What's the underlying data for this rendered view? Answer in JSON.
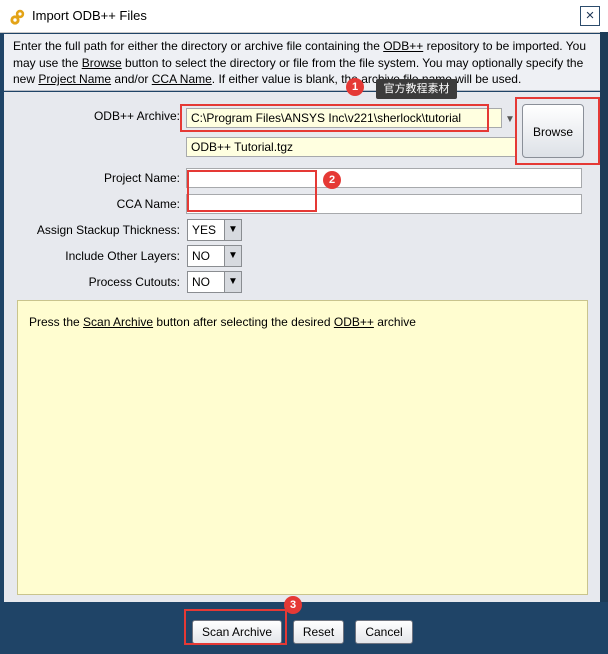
{
  "window": {
    "title": "Import ODB++ Files"
  },
  "description": {
    "p1": "Enter the full path for either the directory or archive file containing the ",
    "link_odb": "ODB++",
    "p2": " repository to be imported. You may use the ",
    "link_browse": "Browse",
    "p3": " button to select the directory or file from the file system. You may optionally specify the new ",
    "link_project": "Project Name",
    "p4": " and/or ",
    "link_cca": "CCA Name",
    "p5": ". If either value is blank, the archive file name will be used."
  },
  "form": {
    "archive_label": "ODB++ Archive:",
    "archive_path": "C:\\Program Files\\ANSYS Inc\\v221\\sherlock\\tutorial",
    "archive_file": "ODB++ Tutorial.tgz",
    "browse_label": "Browse",
    "project_label": "Project Name:",
    "project_value": "",
    "cca_label": "CCA Name:",
    "cca_value": "",
    "stackup_label": "Assign Stackup Thickness:",
    "stackup_value": "YES",
    "layers_label": "Include Other Layers:",
    "layers_value": "NO",
    "cutouts_label": "Process Cutouts:",
    "cutouts_value": "NO"
  },
  "notes": {
    "pre": "Press the ",
    "link_scan": "Scan Archive",
    "mid": " button after selecting the desired ",
    "link_odb": "ODB++",
    "post": " archive"
  },
  "buttons": {
    "scan": "Scan Archive",
    "reset": "Reset",
    "cancel": "Cancel"
  },
  "annotations": {
    "n1": "1",
    "n2": "2",
    "n3": "3",
    "watermark": "官方教程素材"
  },
  "colors": {
    "highlight": "#e53935",
    "field_yellow": "#ffffe0",
    "notes_bg": "#fffdd0",
    "frame": "#1f4467"
  }
}
